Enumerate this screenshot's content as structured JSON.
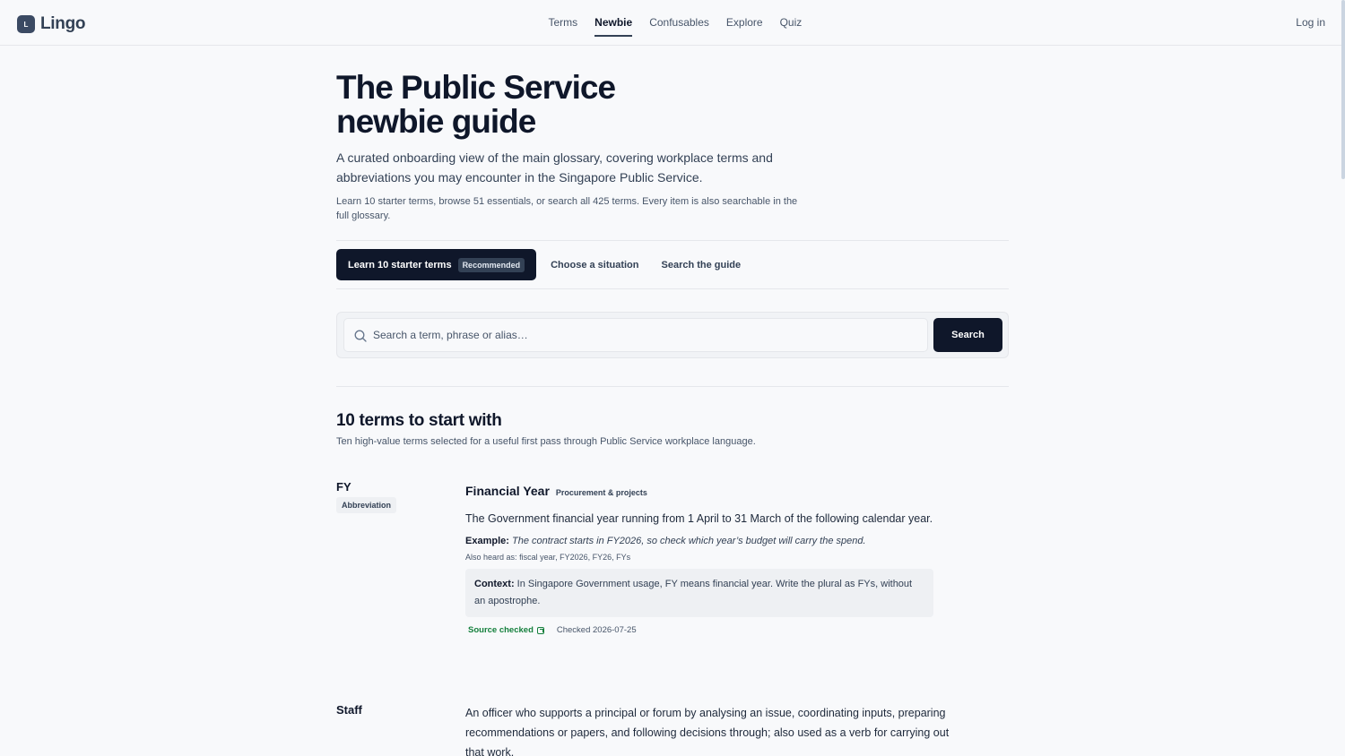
{
  "brand": {
    "mark": "L",
    "name": "Lingo"
  },
  "nav": {
    "items": [
      {
        "label": "Terms",
        "active": false
      },
      {
        "label": "Newbie",
        "active": true
      },
      {
        "label": "Confusables",
        "active": false
      },
      {
        "label": "Explore",
        "active": false
      },
      {
        "label": "Quiz",
        "active": false
      }
    ],
    "login": "Log in"
  },
  "hero": {
    "title": "The Public Service newbie guide",
    "lead": "A curated onboarding view of the main glossary, covering workplace terms and abbreviations you may encounter in the Singapore Public Service.",
    "sub": "Learn 10 starter terms, browse 51 essentials, or search all 425 terms. Every item is also searchable in the full glossary."
  },
  "tabs": {
    "primary": "Learn 10 starter terms",
    "primary_badge": "Recommended",
    "situation": "Choose a situation",
    "search": "Search the guide"
  },
  "search": {
    "placeholder": "Search a term, phrase or alias…",
    "button": "Search"
  },
  "section": {
    "title": "10 terms to start with",
    "subtitle": "Ten high-value terms selected for a useful first pass through Public Service workplace language."
  },
  "terms": [
    {
      "abbr": "FY",
      "tag": "Abbreviation",
      "name": "Financial Year",
      "category": "Procurement & projects",
      "definition": "The Government financial year running from 1 April to 31 March of the following calendar year.",
      "example_label": "Example:",
      "example": "The contract starts in FY2026, so check which year’s budget will carry the spend.",
      "alias_label": "Also heard as:",
      "aliases": "fiscal year, FY2026, FY26, FYs",
      "context_label": "Context:",
      "context": "In Singapore Government usage, FY means financial year. Write the plural as FYs, without an apostrophe.",
      "source": "Source checked",
      "checked": "Checked 2026-07-25"
    },
    {
      "abbr": "Staff",
      "definition": "An officer who supports a principal or forum by analysing an issue, coordinating inputs, preparing recommendations or papers, and following decisions through; also used as a verb for carrying out that work."
    }
  ],
  "colors": {
    "primary": "#0f172a",
    "accent": "#334155",
    "success": "#15803d",
    "background": "#f8f9fb"
  }
}
